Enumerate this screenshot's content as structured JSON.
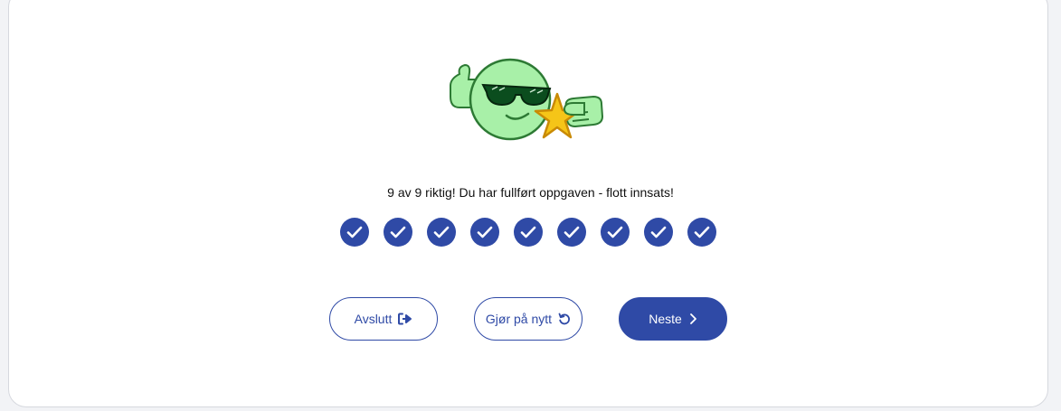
{
  "result": {
    "message": "9 av 9 riktig! Du har fullført oppgaven - flott innsats!",
    "correct": 9,
    "total": 9
  },
  "mascot": {
    "icon": "cool-smiley-thumbs-up-star-icon"
  },
  "buttons": {
    "quit": {
      "label": "Avslutt",
      "icon": "exit-icon"
    },
    "retry": {
      "label": "Gjør på nytt",
      "icon": "retry-icon"
    },
    "next": {
      "label": "Neste",
      "icon": "chevron-right-icon"
    }
  },
  "colors": {
    "accent": "#2f4aa6",
    "mascot_green": "#a8f0a8",
    "star": "#f5c518"
  }
}
